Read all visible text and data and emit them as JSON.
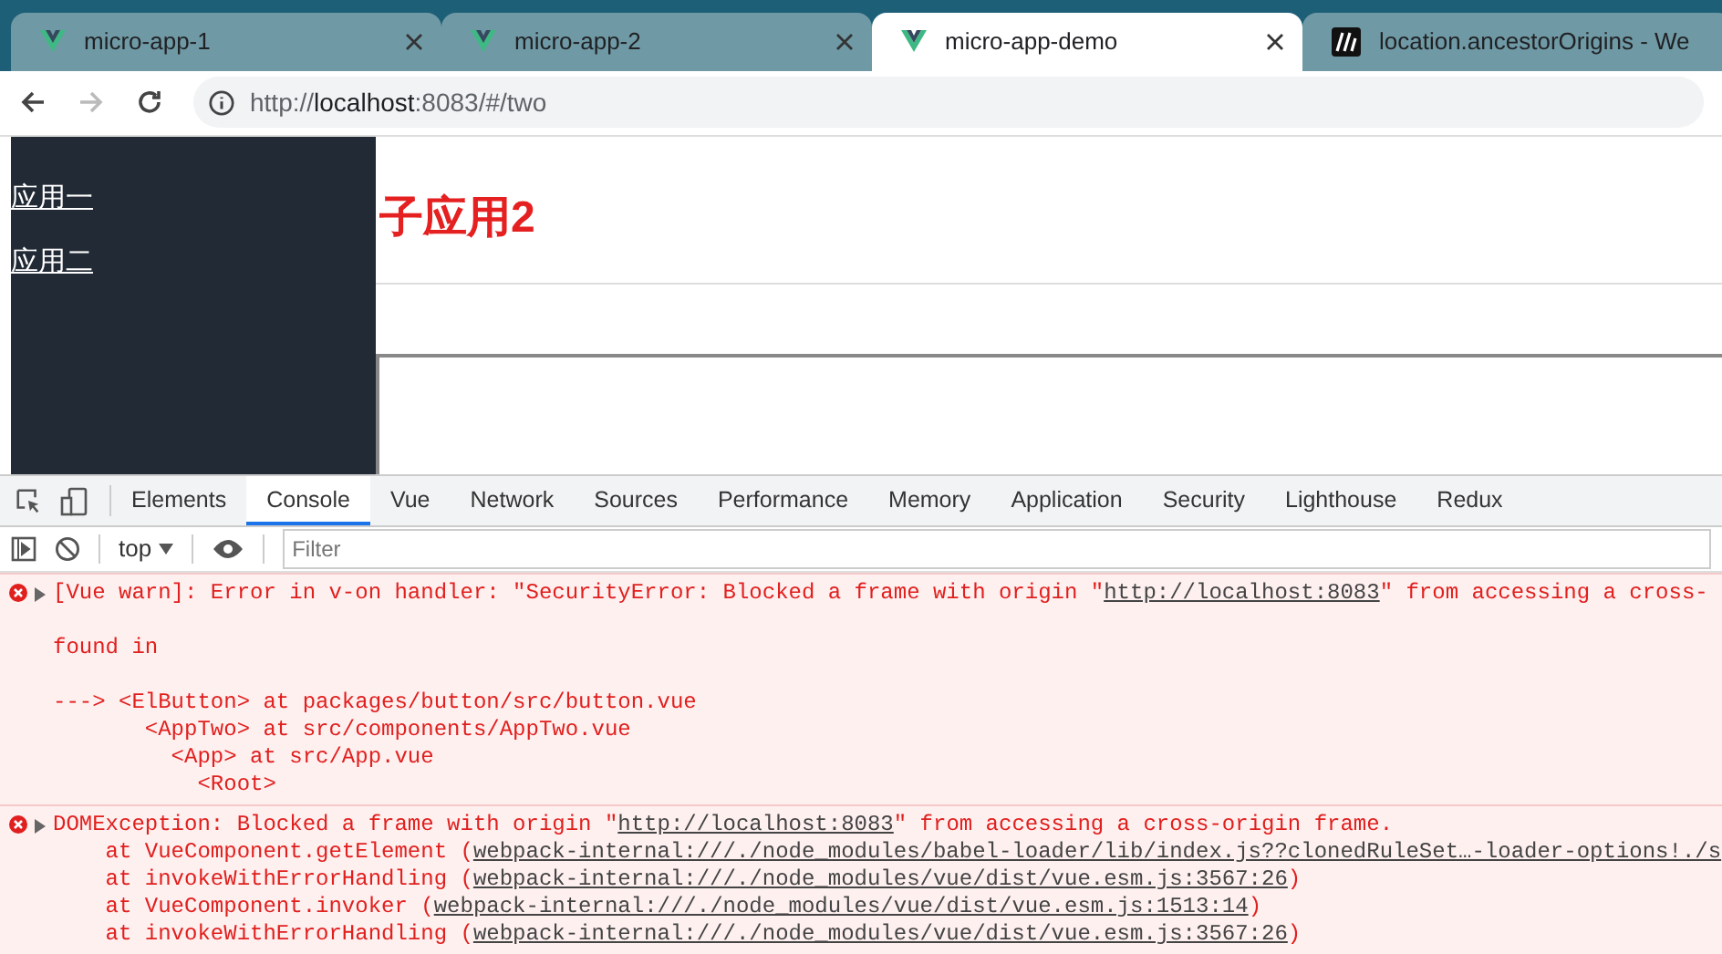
{
  "browser": {
    "tabs": [
      {
        "title": "micro-app-1",
        "kind": "vue",
        "selected": false
      },
      {
        "title": "micro-app-2",
        "kind": "vue",
        "selected": false
      },
      {
        "title": "micro-app-demo",
        "kind": "vue",
        "selected": true
      },
      {
        "title": "location.ancestorOrigins - We",
        "kind": "mdn",
        "selected": false
      }
    ],
    "url": {
      "scheme": "http://",
      "host": "localhost",
      "rest": ":8083/#/two"
    }
  },
  "page": {
    "sidebar": {
      "links": [
        "应用一",
        "应用二"
      ]
    },
    "heading": "子应用2"
  },
  "devtools": {
    "tabs": [
      {
        "label": "Elements",
        "selected": false
      },
      {
        "label": "Console",
        "selected": true
      },
      {
        "label": "Vue",
        "selected": false
      },
      {
        "label": "Network",
        "selected": false
      },
      {
        "label": "Sources",
        "selected": false
      },
      {
        "label": "Performance",
        "selected": false
      },
      {
        "label": "Memory",
        "selected": false
      },
      {
        "label": "Application",
        "selected": false
      },
      {
        "label": "Security",
        "selected": false
      },
      {
        "label": "Lighthouse",
        "selected": false
      },
      {
        "label": "Redux",
        "selected": false
      }
    ],
    "context": "top",
    "filter": {
      "placeholder": "Filter"
    },
    "messages": [
      {
        "paragraphs": [
          [
            [
              {
                "kind": "text",
                "text": "[Vue warn]: Error in v-on handler: \"SecurityError: Blocked a frame with origin \""
              },
              {
                "kind": "link",
                "text": "http://localhost:8083"
              },
              {
                "kind": "text",
                "text": "\" from accessing a cross-"
              }
            ]
          ],
          [
            [
              {
                "kind": "text",
                "text": "found in"
              }
            ]
          ],
          [
            [
              {
                "kind": "text",
                "text": "---> <ElButton> at packages/button/src/button.vue"
              }
            ],
            [
              {
                "kind": "text",
                "text": "       <AppTwo> at src/components/AppTwo.vue"
              }
            ],
            [
              {
                "kind": "text",
                "text": "         <App> at src/App.vue"
              }
            ],
            [
              {
                "kind": "text",
                "text": "           <Root>"
              }
            ]
          ]
        ]
      },
      {
        "paragraphs": [
          [
            [
              {
                "kind": "text",
                "text": "DOMException: Blocked a frame with origin \""
              },
              {
                "kind": "link",
                "text": "http://localhost:8083"
              },
              {
                "kind": "text",
                "text": "\" from accessing a cross-origin frame."
              }
            ],
            [
              {
                "kind": "text",
                "text": "    at VueComponent.getElement ("
              },
              {
                "kind": "link",
                "text": "webpack-internal:///./node_modules/babel-loader/lib/index.js??clonedRuleSet…-loader-options!./s"
              }
            ],
            [
              {
                "kind": "text",
                "text": "    at invokeWithErrorHandling ("
              },
              {
                "kind": "link",
                "text": "webpack-internal:///./node_modules/vue/dist/vue.esm.js:3567:26"
              },
              {
                "kind": "text",
                "text": ")"
              }
            ],
            [
              {
                "kind": "text",
                "text": "    at VueComponent.invoker ("
              },
              {
                "kind": "link",
                "text": "webpack-internal:///./node_modules/vue/dist/vue.esm.js:1513:14"
              },
              {
                "kind": "text",
                "text": ")"
              }
            ],
            [
              {
                "kind": "text",
                "text": "    at invokeWithErrorHandling ("
              },
              {
                "kind": "link",
                "text": "webpack-internal:///./node_modules/vue/dist/vue.esm.js:3567:26"
              },
              {
                "kind": "text",
                "text": ")"
              }
            ]
          ]
        ]
      }
    ]
  }
}
